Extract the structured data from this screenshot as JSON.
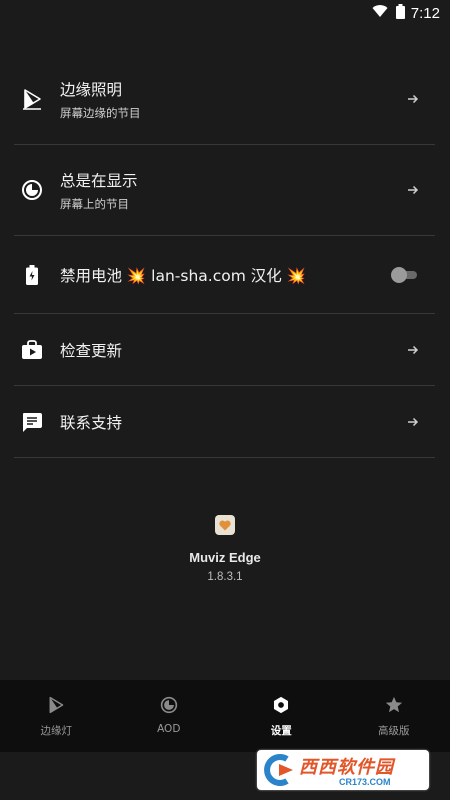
{
  "status_bar": {
    "time": "7:12",
    "icons": [
      "wifi-icon",
      "battery-icon"
    ]
  },
  "menu": {
    "items": [
      {
        "title": "边缘照明",
        "subtitle": "屏幕边缘的节目",
        "icon": "edge-light-icon",
        "trailing": "arrow"
      },
      {
        "title": "总是在显示",
        "subtitle": "屏幕上的节目",
        "icon": "always-on-display-icon",
        "trailing": "arrow"
      },
      {
        "title": "禁用电池 💥 lan-sha.com 汉化 💥",
        "icon": "battery-icon",
        "trailing": "toggle",
        "toggle_on": false
      },
      {
        "title": "检查更新",
        "icon": "store-icon",
        "trailing": "arrow"
      },
      {
        "title": "联系支持",
        "icon": "chat-icon",
        "trailing": "arrow"
      }
    ]
  },
  "app_info": {
    "name": "Muviz Edge",
    "version": "1.8.3.1",
    "logo": "heart-logo"
  },
  "bottom_nav": {
    "tabs": [
      {
        "label": "边缘灯",
        "icon": "edge-light-icon",
        "active": false
      },
      {
        "label": "AOD",
        "icon": "aod-icon",
        "active": false
      },
      {
        "label": "设置",
        "icon": "gear-icon",
        "active": true
      },
      {
        "label": "高级版",
        "icon": "star-icon",
        "active": false
      }
    ]
  },
  "watermark": {
    "main": "西西软件园",
    "sub": "CR173.COM"
  },
  "colors": {
    "background": "#1b1b1b",
    "divider": "#383838",
    "nav_background": "#0e0e0e",
    "accent_logo": "#e0913a"
  }
}
